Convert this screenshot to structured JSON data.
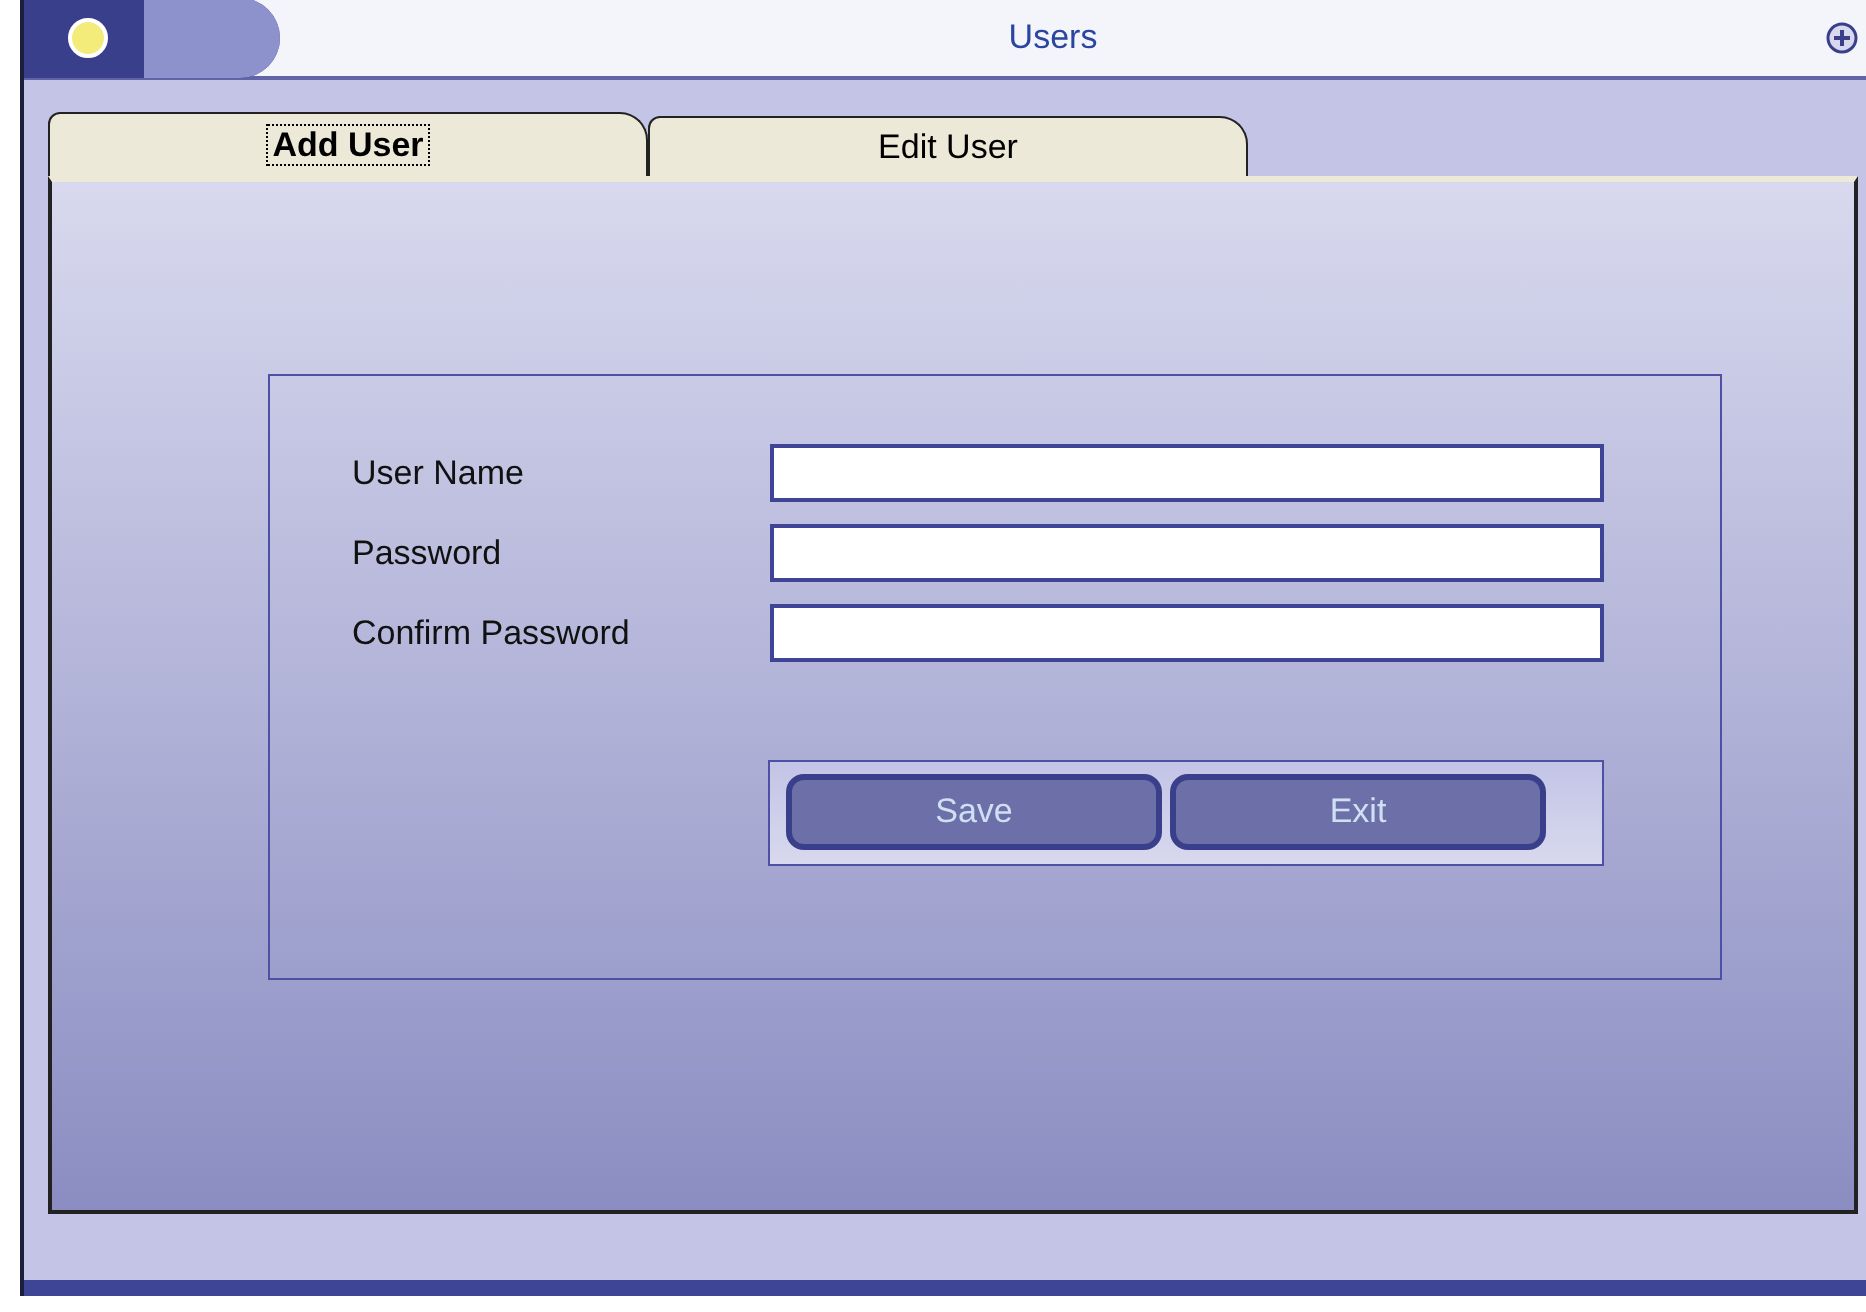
{
  "window": {
    "title": "Users"
  },
  "tabs": [
    {
      "label": "Add User",
      "selected": true
    },
    {
      "label": "Edit User",
      "selected": false
    }
  ],
  "form": {
    "fields": [
      {
        "label": "User Name"
      },
      {
        "label": "Password"
      },
      {
        "label": "Confirm Password"
      }
    ],
    "buttons": [
      "Save",
      "Exit"
    ]
  }
}
